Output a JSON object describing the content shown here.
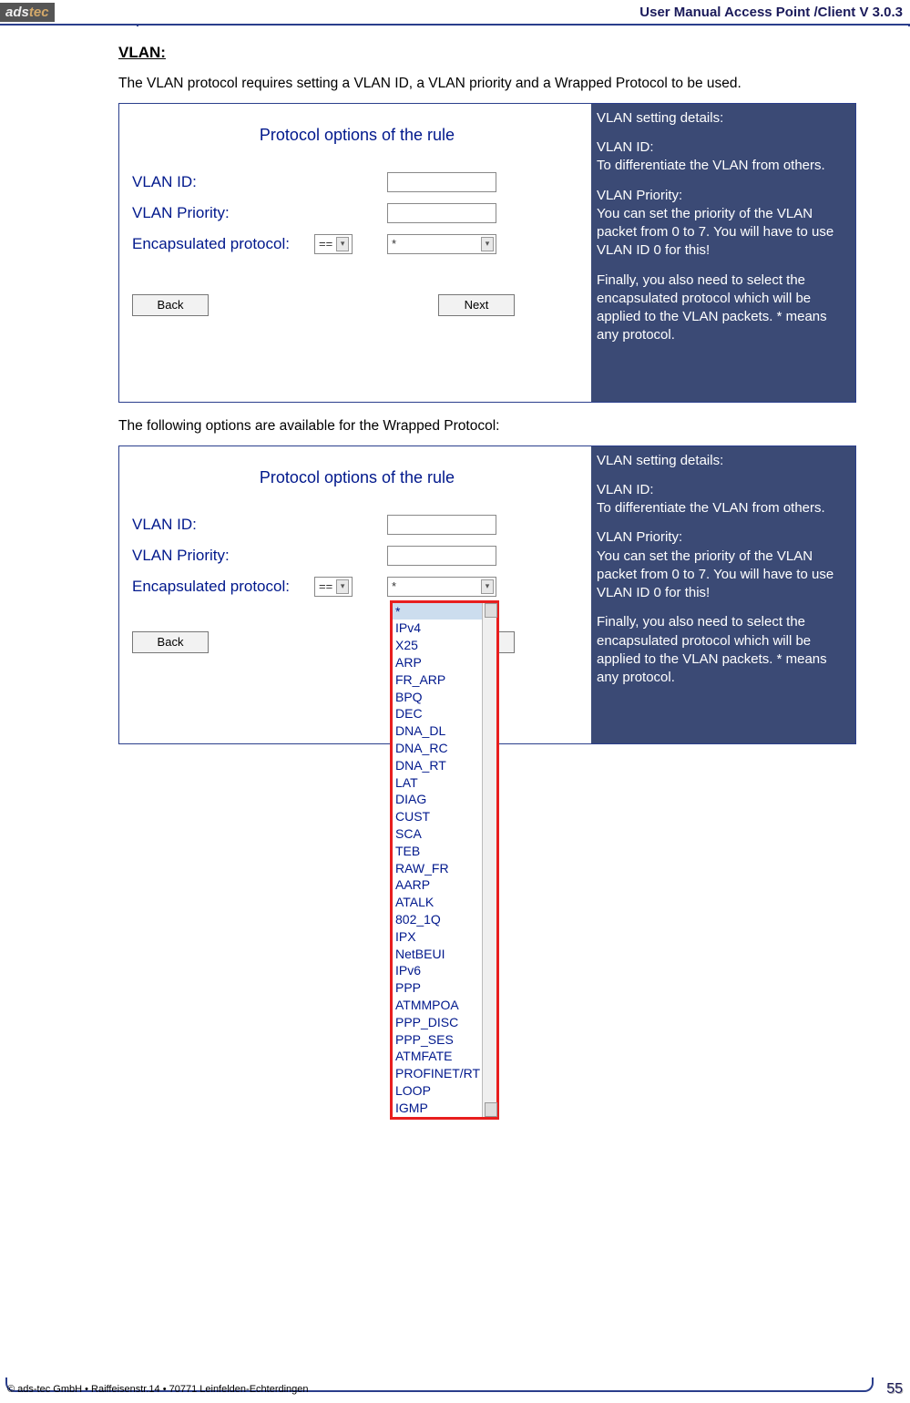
{
  "header": {
    "logo_ads": "ads",
    "logo_tec": "tec",
    "title": "User Manual Access  Point /Client V 3.0.3"
  },
  "section_title": "VLAN:",
  "para1": "The VLAN protocol requires setting a VLAN ID, a VLAN priority and a Wrapped Protocol to be used.",
  "para2": "The following options are available for the Wrapped Protocol:",
  "dialog": {
    "title": "Protocol options of the rule",
    "labels": {
      "vlan_id": "VLAN ID:",
      "vlan_priority": "VLAN Priority:",
      "encapsulated": "Encapsulated protocol:"
    },
    "op_small_value": "==",
    "op_wide_value": "*",
    "back": "Back",
    "next": "Next"
  },
  "sidebar": {
    "heading": "VLAN setting details:",
    "b1_t": "VLAN ID:",
    "b1_c": "To differentiate the VLAN from others.",
    "b2_t": "VLAN Priority:",
    "b2_c": "You can set the priority of the VLAN packet from 0 to 7. You will have to use VLAN ID 0 for this!",
    "b3": "Finally, you also need to select the encapsulated protocol which will be applied to the VLAN packets. * means any protocol."
  },
  "dropdown_items": [
    "*",
    "IPv4",
    "X25",
    "ARP",
    "FR_ARP",
    "BPQ",
    "DEC",
    "DNA_DL",
    "DNA_RC",
    "DNA_RT",
    "LAT",
    "DIAG",
    "CUST",
    "SCA",
    "TEB",
    "RAW_FR",
    "AARP",
    "ATALK",
    "802_1Q",
    "IPX",
    "NetBEUI",
    "IPv6",
    "PPP",
    "ATMMPOA",
    "PPP_DISC",
    "PPP_SES",
    "ATMFATE",
    "PROFINET/RT",
    "LOOP",
    "IGMP"
  ],
  "footer": {
    "copyright": "© ads-tec GmbH • Raiffeisenstr.14 • 70771 Leinfelden-Echterdingen",
    "page": "55"
  }
}
